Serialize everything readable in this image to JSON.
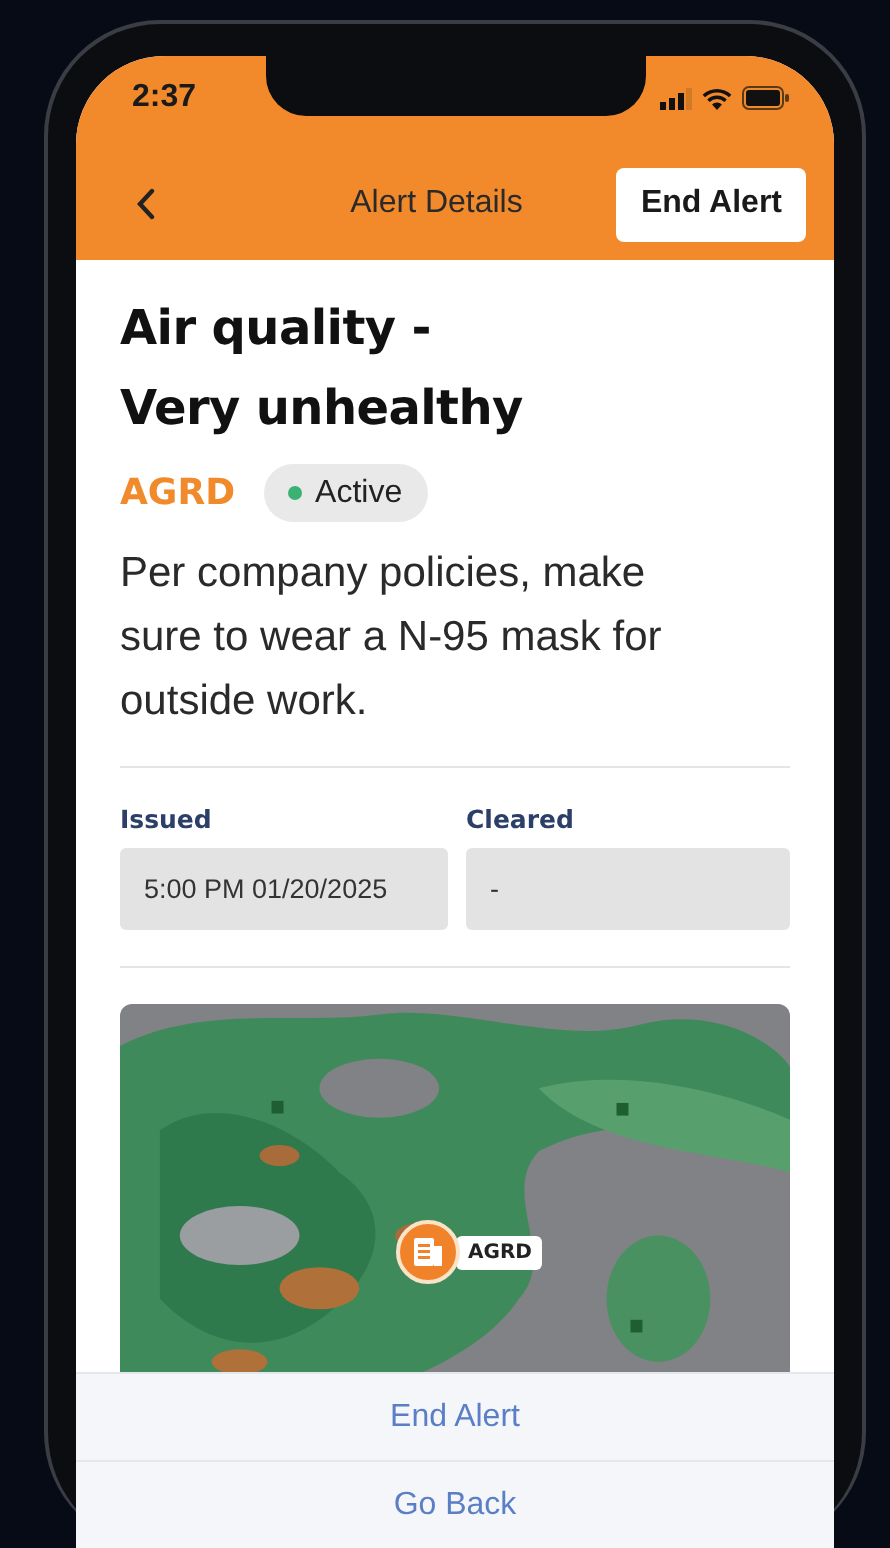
{
  "status_bar": {
    "time": "2:37"
  },
  "nav": {
    "title": "Alert Details",
    "action": "End Alert"
  },
  "alert": {
    "title_lines": [
      "Air quality -",
      "Very unhealthy"
    ],
    "site": "AGRD",
    "status": {
      "label": "Active",
      "active": true
    },
    "description": "Per company policies, make sure to wear a N-95 mask for outside work."
  },
  "details": [
    {
      "label": "Issued",
      "value": "5:00 PM 01/20/2025"
    },
    {
      "label": "Cleared",
      "value": "-"
    }
  ],
  "map": {
    "kind": "picture",
    "marker_label": "AGRD"
  },
  "actions": [
    "End Alert",
    "Go Back"
  ]
}
